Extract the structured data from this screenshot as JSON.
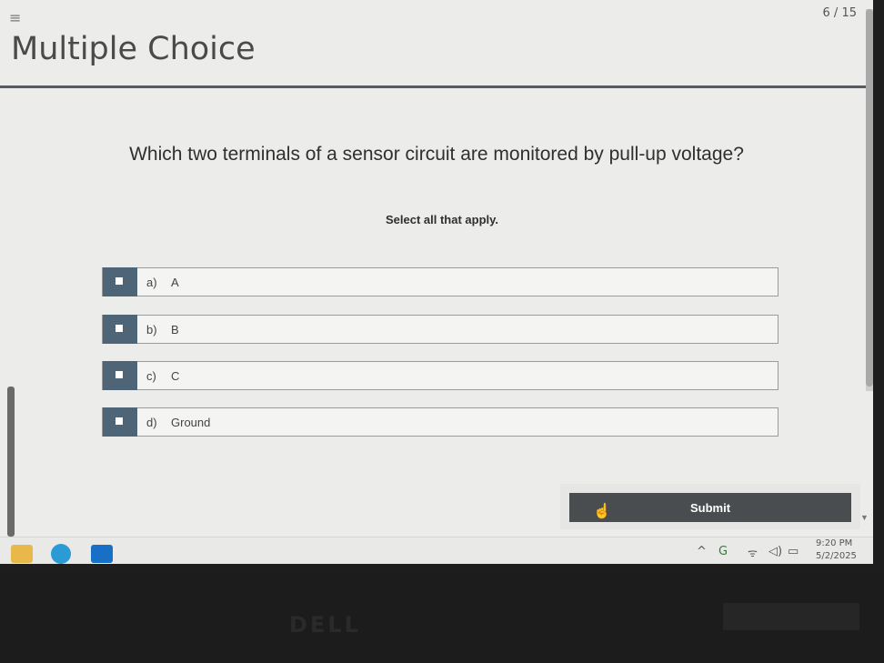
{
  "header": {
    "menu_icon": "≡",
    "counter": "6 / 15",
    "title": "Multiple Choice"
  },
  "question": {
    "text": "Which two terminals of a sensor circuit are monitored by pull-up voltage?",
    "instruction": "Select all that apply."
  },
  "options": [
    {
      "letter": "a)",
      "text": "A"
    },
    {
      "letter": "b)",
      "text": "B"
    },
    {
      "letter": "c)",
      "text": "C"
    },
    {
      "letter": "d)",
      "text": "Ground"
    }
  ],
  "submit": {
    "label": "Submit"
  },
  "taskbar": {
    "apps": [
      "folder-icon",
      "edge-icon",
      "outlook-icon"
    ],
    "tray_icons": [
      "chevron-up-icon",
      "onedrive-icon",
      "wifi-icon",
      "volume-icon",
      "battery-icon"
    ],
    "time": "9:20 PM",
    "date": "5/2/2025"
  },
  "colors": {
    "checkbox": "#4e6577",
    "submit_bg": "#4a4d4f",
    "title_rule": "#555b5e"
  }
}
